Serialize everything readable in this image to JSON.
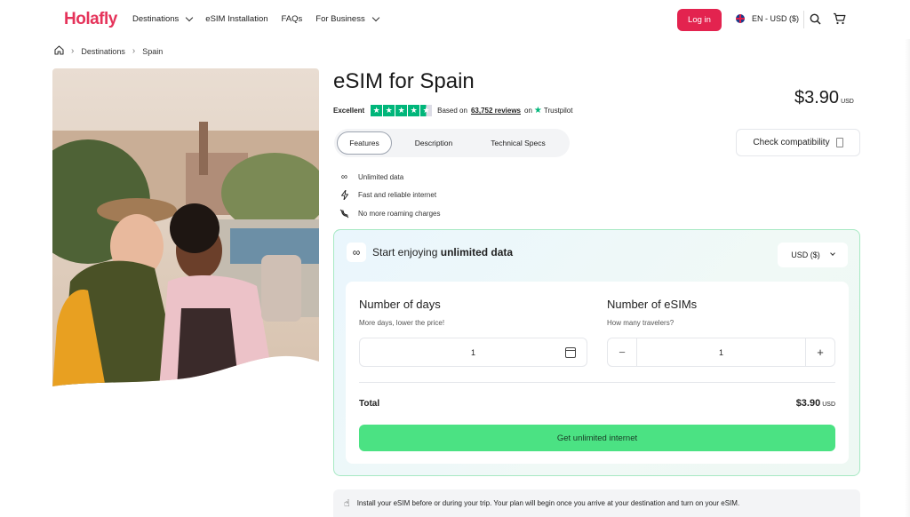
{
  "nav": {
    "logo": "Holafly",
    "links": [
      "Destinations",
      "eSIM Installation",
      "FAQs",
      "For Business"
    ],
    "login": "Log in",
    "language": "EN - USD ($)"
  },
  "breadcrumb": {
    "items": [
      "Destinations",
      "Spain"
    ]
  },
  "product": {
    "title": "eSIM for Spain",
    "price": "$3.90",
    "price_currency": "USD",
    "rating_label": "Excellent",
    "reviews_prefix": "Based on",
    "reviews_count": "63,752 reviews",
    "reviews_on": "on",
    "trustpilot": "Trustpilot",
    "stars": 4.5
  },
  "tabs": [
    "Features",
    "Description",
    "Technical Specs"
  ],
  "check_compatibility": "Check compatibility",
  "features": [
    {
      "icon": "infinity-icon",
      "label": "Unlimited data"
    },
    {
      "icon": "lightning-icon",
      "label": "Fast and reliable internet"
    },
    {
      "icon": "no-roaming-icon",
      "label": "No more roaming charges"
    }
  ],
  "plan": {
    "title_prefix": "Start enjoying",
    "title_bold": "unlimited data",
    "currency_select": "USD ($)",
    "days_title": "Number of days",
    "days_sub": "More days, lower the price!",
    "days_value": "1",
    "esims_title": "Number of eSIMs",
    "esims_sub": "How many travelers?",
    "esims_value": "1",
    "minus": "−",
    "plus": "+",
    "total_label": "Total",
    "total_value": "$3.90",
    "total_currency": "USD",
    "cta": "Get unlimited internet"
  },
  "notice": "Install your eSIM before or during your trip. Your plan will begin once you arrive at your destination and turn on your eSIM.",
  "colors": {
    "brand": "#e5335a",
    "login_bg": "#e3234f",
    "cta": "#4be283",
    "trustpilot": "#00b67a"
  }
}
